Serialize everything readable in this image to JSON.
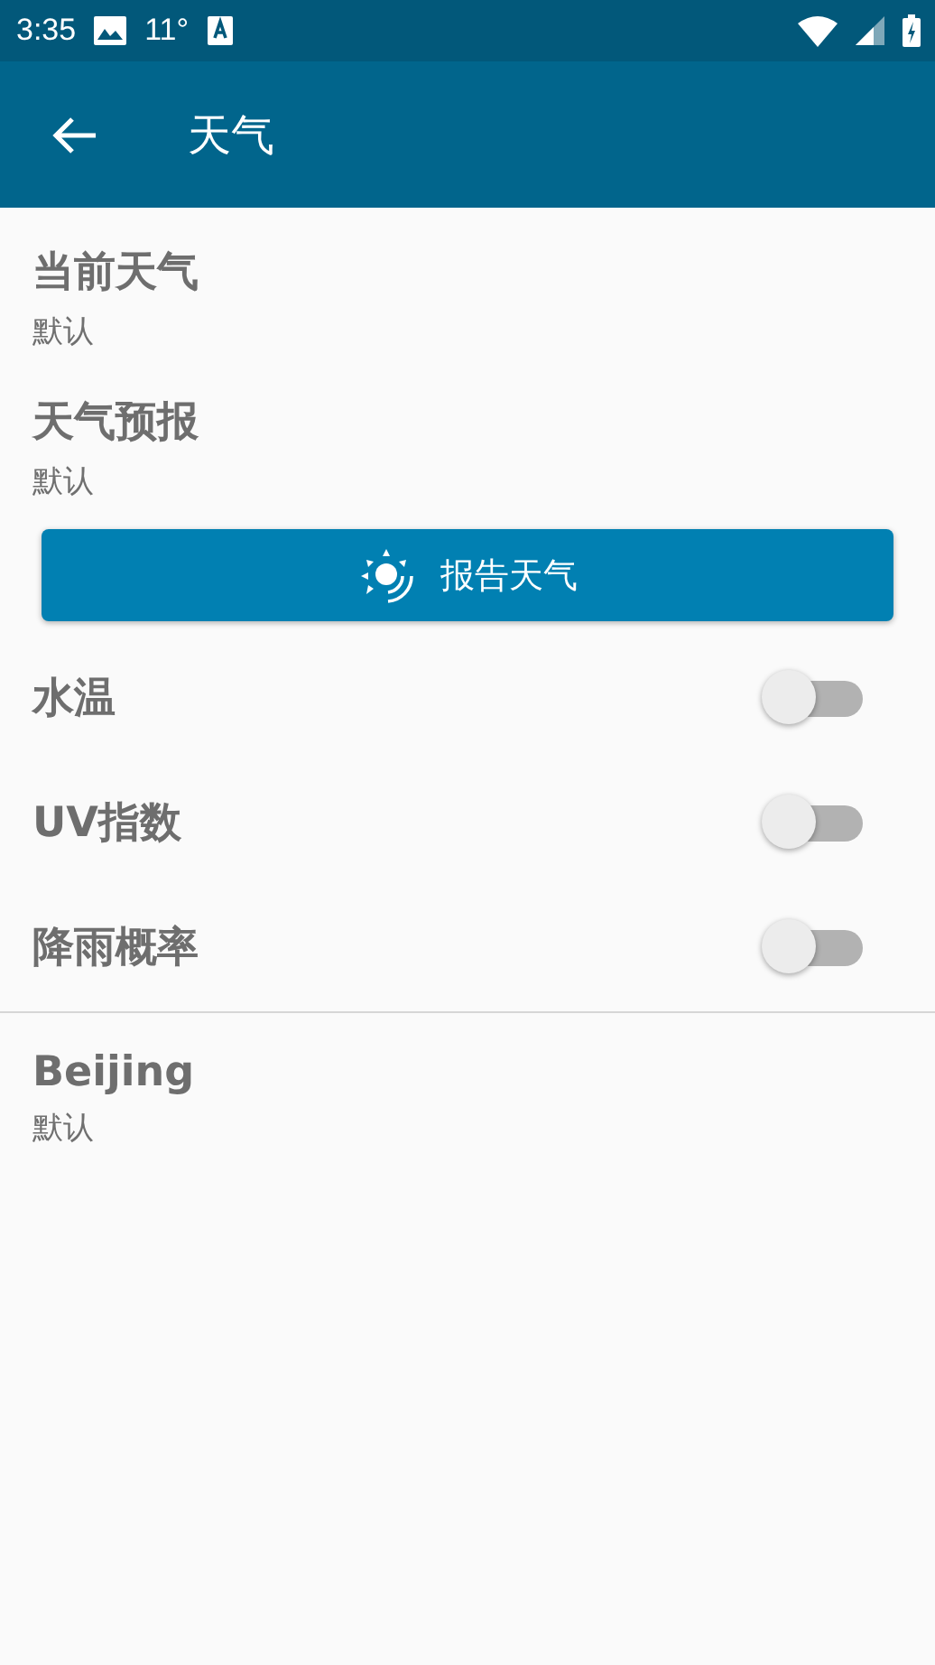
{
  "status_bar": {
    "time": "3:35",
    "temperature": "11°"
  },
  "app_bar": {
    "title": "天气"
  },
  "preferences": [
    {
      "title": "当前天气",
      "summary": "默认"
    },
    {
      "title": "天气预报",
      "summary": "默认"
    }
  ],
  "report_button": {
    "label": "报告天气"
  },
  "toggles": [
    {
      "label": "水温",
      "on": false
    },
    {
      "label": "UV指数",
      "on": false
    },
    {
      "label": "降雨概率",
      "on": false
    }
  ],
  "location": {
    "title": "Beijing",
    "summary": "默认"
  }
}
